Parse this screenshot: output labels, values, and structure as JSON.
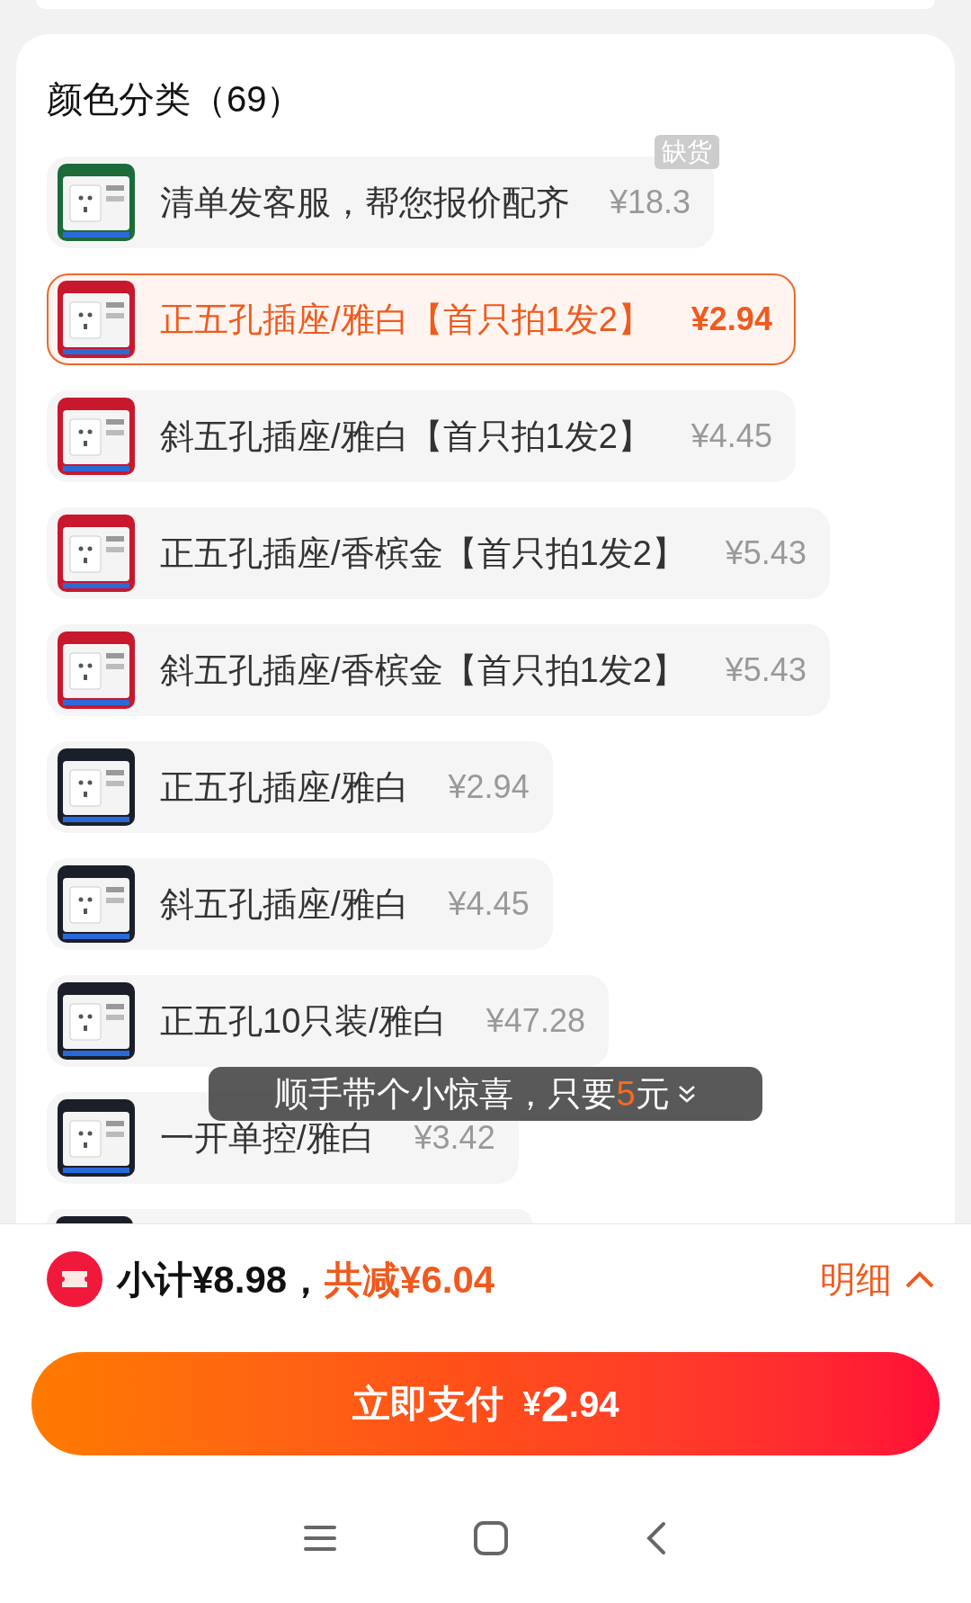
{
  "section": {
    "title": "颜色分类（69）"
  },
  "options": [
    {
      "kind": "option",
      "label": "清单发客服，帮您报价配齐",
      "price": "¥18.3",
      "selected": false,
      "badge": "缺货"
    },
    {
      "kind": "option",
      "label": "正五孔插座/雅白【首只拍1发2】",
      "price": "¥2.94",
      "selected": true
    },
    {
      "kind": "option",
      "label": "斜五孔插座/雅白【首只拍1发2】",
      "price": "¥4.45",
      "selected": false
    },
    {
      "kind": "option",
      "label": "正五孔插座/香槟金【首只拍1发2】",
      "price": "¥5.43",
      "selected": false
    },
    {
      "kind": "option",
      "label": "斜五孔插座/香槟金【首只拍1发2】",
      "price": "¥5.43",
      "selected": false
    },
    {
      "kind": "option",
      "label": "正五孔插座/雅白",
      "price": "¥2.94",
      "selected": false
    },
    {
      "kind": "option",
      "label": "斜五孔插座/雅白",
      "price": "¥4.45",
      "selected": false
    },
    {
      "kind": "option",
      "label": "正五孔10只装/雅白",
      "price": "¥47.28",
      "selected": false
    },
    {
      "kind": "option",
      "label": "一开单控/雅白",
      "price": "¥3.42",
      "selected": false
    },
    {
      "kind": "cut"
    }
  ],
  "toast": {
    "text": "顺手带个小惊喜，只要",
    "amount": "5",
    "unit": "元"
  },
  "summary": {
    "subtotal": "小计¥8.98，",
    "discount": "共减¥6.04",
    "details": "明细"
  },
  "pay_button": {
    "label": "立即支付",
    "currency": "¥",
    "amount_int": "2",
    "amount_dec": ".94"
  }
}
